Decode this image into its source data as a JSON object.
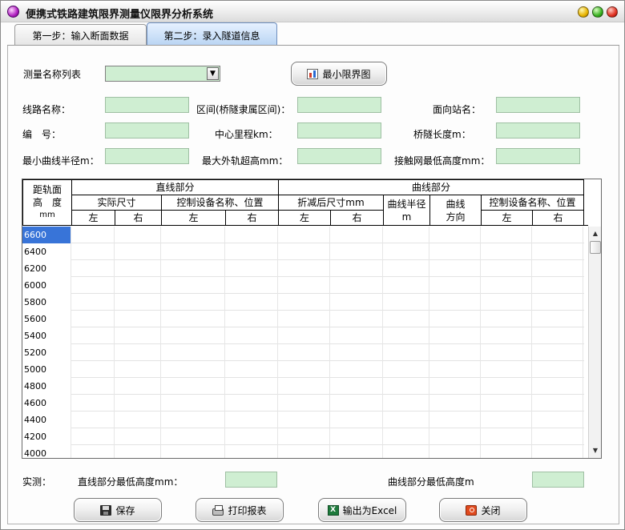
{
  "window": {
    "title": "便携式铁路建筑限界测量仪限界分析系统"
  },
  "tabs": [
    {
      "label": "第一步：输入断面数据"
    },
    {
      "label": "第二步：录入隧道信息"
    }
  ],
  "form": {
    "survey_list_label": "测量名称列表",
    "min_clearance_button": "最小限界图",
    "line_name_label": "线路名称：",
    "section_label": "区间(桥隧隶属区间)：",
    "facing_station_label": "面向站名：",
    "number_label": "编　号：",
    "center_mileage_label": "中心里程km：",
    "length_label": "桥隧长度m：",
    "min_radius_label": "最小曲线半径m：",
    "max_superelevation_label": "最大外轨超高mm：",
    "min_catenary_label": "接触网最低高度mm："
  },
  "table": {
    "col_distance_header": [
      "距轨面",
      "高　度",
      "mm"
    ],
    "straight_header": "直线部分",
    "curve_header": "曲线部分",
    "actual_size": "实际尺寸",
    "control_device": "控制设备名称、位置",
    "reduced_size": "折减后尺寸mm",
    "curve_radius": [
      "曲线半径",
      "m"
    ],
    "curve_direction": [
      "曲线",
      "方向"
    ],
    "control_device_curve": "控制设备名称、位置",
    "left": "左",
    "right": "右",
    "heights": [
      "6600",
      "6400",
      "6200",
      "6000",
      "5800",
      "5600",
      "5400",
      "5200",
      "5000",
      "4800",
      "4600",
      "4400",
      "4200",
      "4000"
    ]
  },
  "footer": {
    "measured_label": "实测：",
    "straight_min_label": "直线部分最低高度mm：",
    "curve_min_label": "曲线部分最低高度m"
  },
  "buttons": {
    "save": "保存",
    "print": "打印报表",
    "excel": "输出为Excel",
    "close": "关闭"
  },
  "icons": {
    "app": "app-icon",
    "chart": "chart-icon",
    "save": "floppy-icon",
    "print": "printer-icon",
    "excel": "excel-icon",
    "close": "power-icon"
  },
  "colors": {
    "field_bg": "#cfeed2",
    "active_tab": "#b9d4f3",
    "selected_row": "#3874d8"
  }
}
